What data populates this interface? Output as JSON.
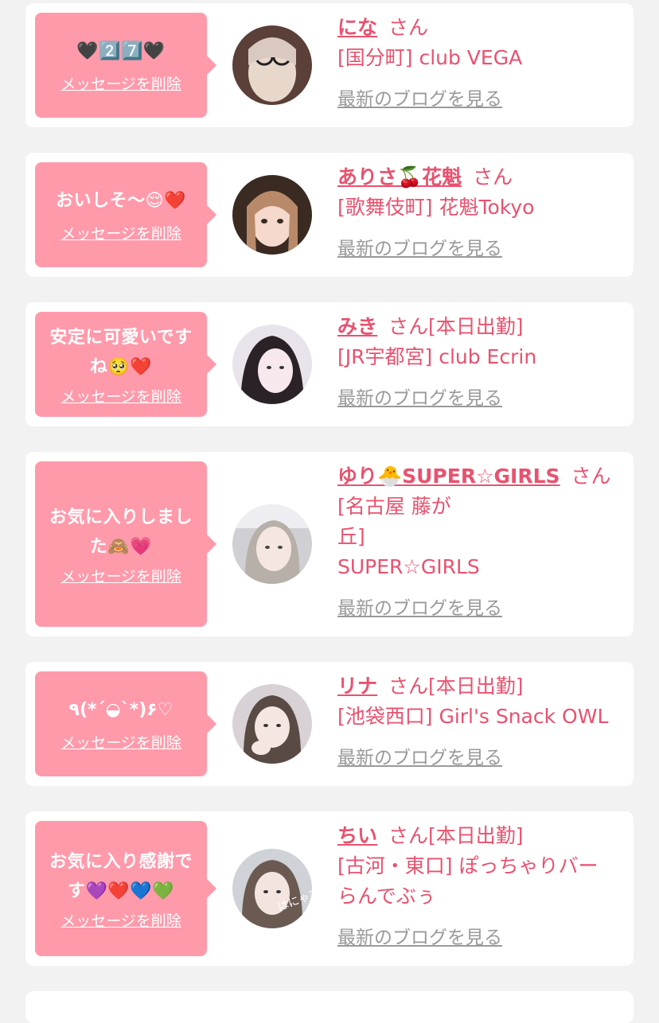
{
  "delete_label": "メッセージを削除",
  "blog_label": "最新のブログを見る",
  "colors": {
    "bubble": "#ff9aab",
    "accent": "#e8526f",
    "muted": "#9a9a9a",
    "background": "#f2f2f2"
  },
  "cards": [
    {
      "message": "🖤2️⃣7️⃣🖤",
      "name": "にな",
      "suffix": "さん",
      "shop": "[国分町] club VEGA"
    },
    {
      "message": "おいしそ〜😌❤️",
      "name": "ありさ🍒花魁",
      "suffix": "さん",
      "shop": "[歌舞伎町] 花魁Tokyo"
    },
    {
      "message": "安定に可愛いですね🥺❤️",
      "name": "みき",
      "suffix": "さん[本日出勤]",
      "shop": "[JR宇都宮] club Ecrin"
    },
    {
      "message": "お気に入りしました🙈💗",
      "name": "ゆり🐣SUPER☆GIRLS",
      "suffix": "さん",
      "shop": "[名古屋 藤が丘] SUPER☆GIRLS"
    },
    {
      "message": "٩(*´◒`*)۶♡",
      "name": "リナ",
      "suffix": "さん[本日出勤]",
      "shop": "[池袋西口] Girl's Snack OWL"
    },
    {
      "message": "お気に入り感謝です💜❤️💙💚",
      "name": "ちい",
      "suffix": "さん[本日出勤]",
      "shop": "[古河・東口] ぽっちゃりバーらんでぶぅ"
    }
  ]
}
